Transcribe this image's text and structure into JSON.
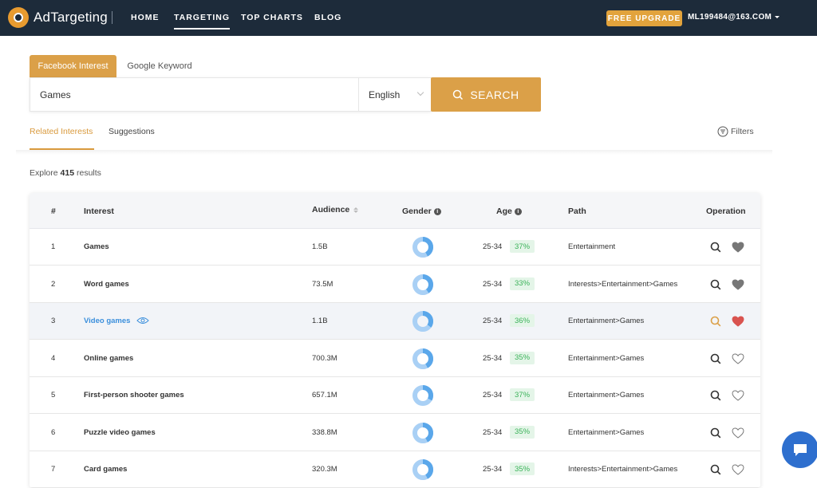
{
  "brand": {
    "name": "AdTargeting"
  },
  "nav": {
    "home": "HOME",
    "targeting": "TARGETING",
    "top_charts": "TOP CHARTS",
    "blog": "BLOG"
  },
  "account": {
    "upgrade": "FREE UPGRADE",
    "email": "ML199484@163.COM"
  },
  "search": {
    "tabs": [
      "Facebook Interest",
      "Google Keyword"
    ],
    "value": "Games",
    "language": "English",
    "button": "SEARCH"
  },
  "content_tabs": {
    "related": "Related Interests",
    "suggestions": "Suggestions",
    "filters": "Filters"
  },
  "results": {
    "prefix": "Explore",
    "count": "415",
    "suffix": "results"
  },
  "table": {
    "headers": {
      "num": "#",
      "interest": "Interest",
      "audience": "Audience",
      "gender": "Gender",
      "age": "Age",
      "path": "Path",
      "operation": "Operation"
    },
    "rows": [
      {
        "num": "1",
        "interest": "Games",
        "audience": "1.5B",
        "gender_share": 0.42,
        "age": "25-34",
        "age_pct": "37%",
        "path": "Entertainment",
        "liked": true
      },
      {
        "num": "2",
        "interest": "Word games",
        "audience": "73.5M",
        "gender_share": 0.4,
        "age": "25-34",
        "age_pct": "33%",
        "path": "Interests>Entertainment>Games",
        "liked": true
      },
      {
        "num": "3",
        "interest": "Video games",
        "audience": "1.1B",
        "gender_share": 0.35,
        "age": "25-34",
        "age_pct": "36%",
        "path": "Entertainment>Games",
        "liked": true,
        "highlighted": true
      },
      {
        "num": "4",
        "interest": "Online games",
        "audience": "700.3M",
        "gender_share": 0.42,
        "age": "25-34",
        "age_pct": "35%",
        "path": "Entertainment>Games",
        "liked": false
      },
      {
        "num": "5",
        "interest": "First-person shooter games",
        "audience": "657.1M",
        "gender_share": 0.33,
        "age": "25-34",
        "age_pct": "37%",
        "path": "Entertainment>Games",
        "liked": false
      },
      {
        "num": "6",
        "interest": "Puzzle video games",
        "audience": "338.8M",
        "gender_share": 0.42,
        "age": "25-34",
        "age_pct": "35%",
        "path": "Entertainment>Games",
        "liked": false
      },
      {
        "num": "7",
        "interest": "Card games",
        "audience": "320.3M",
        "gender_share": 0.42,
        "age": "25-34",
        "age_pct": "35%",
        "path": "Interests>Entertainment>Games",
        "liked": false
      }
    ]
  },
  "colors": {
    "accent": "#dba048",
    "nav_bg": "#1d2b3a",
    "link": "#3b8fdc",
    "heart_liked_gray": "#777777",
    "heart_liked_red": "#d9534f",
    "age_badge_bg": "#e4f5e8",
    "age_badge_text": "#3cb35a",
    "chat": "#2e6fce"
  },
  "icons": {
    "search": "search-icon",
    "filters": "filters-icon",
    "eye": "eye-icon",
    "heart": "heart-icon",
    "chat": "chat-icon"
  }
}
